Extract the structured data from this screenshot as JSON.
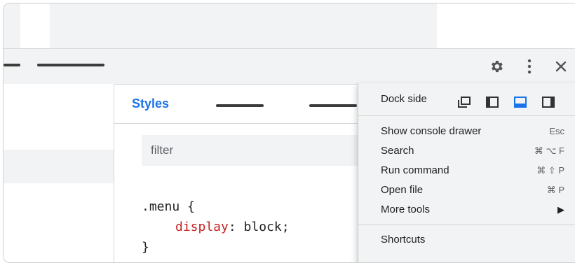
{
  "styles_panel": {
    "title": "Styles",
    "filter_placeholder": "filter",
    "code": {
      "selector_line": ".menu {",
      "property": "display",
      "value_part": ": block;",
      "close_line": "}"
    }
  },
  "menu": {
    "dock_side_label": "Dock side",
    "dock_icons": [
      "undock-icon",
      "dock-left-icon",
      "dock-bottom-icon",
      "dock-right-icon"
    ],
    "selected_dock": "dock-bottom-icon",
    "items": [
      {
        "label": "Show console drawer",
        "shortcut": "Esc"
      },
      {
        "label": "Search",
        "shortcut": "⌘ ⌥ F"
      },
      {
        "label": "Run command",
        "shortcut": "⌘ ⇧ P"
      },
      {
        "label": "Open file",
        "shortcut": "⌘ P"
      },
      {
        "label": "More tools",
        "shortcut": "▶"
      }
    ],
    "last_item": "Shortcuts"
  },
  "colors": {
    "accent": "#1a73e8",
    "property": "#c5221f",
    "toolbar_bg": "#f1f3f4"
  }
}
